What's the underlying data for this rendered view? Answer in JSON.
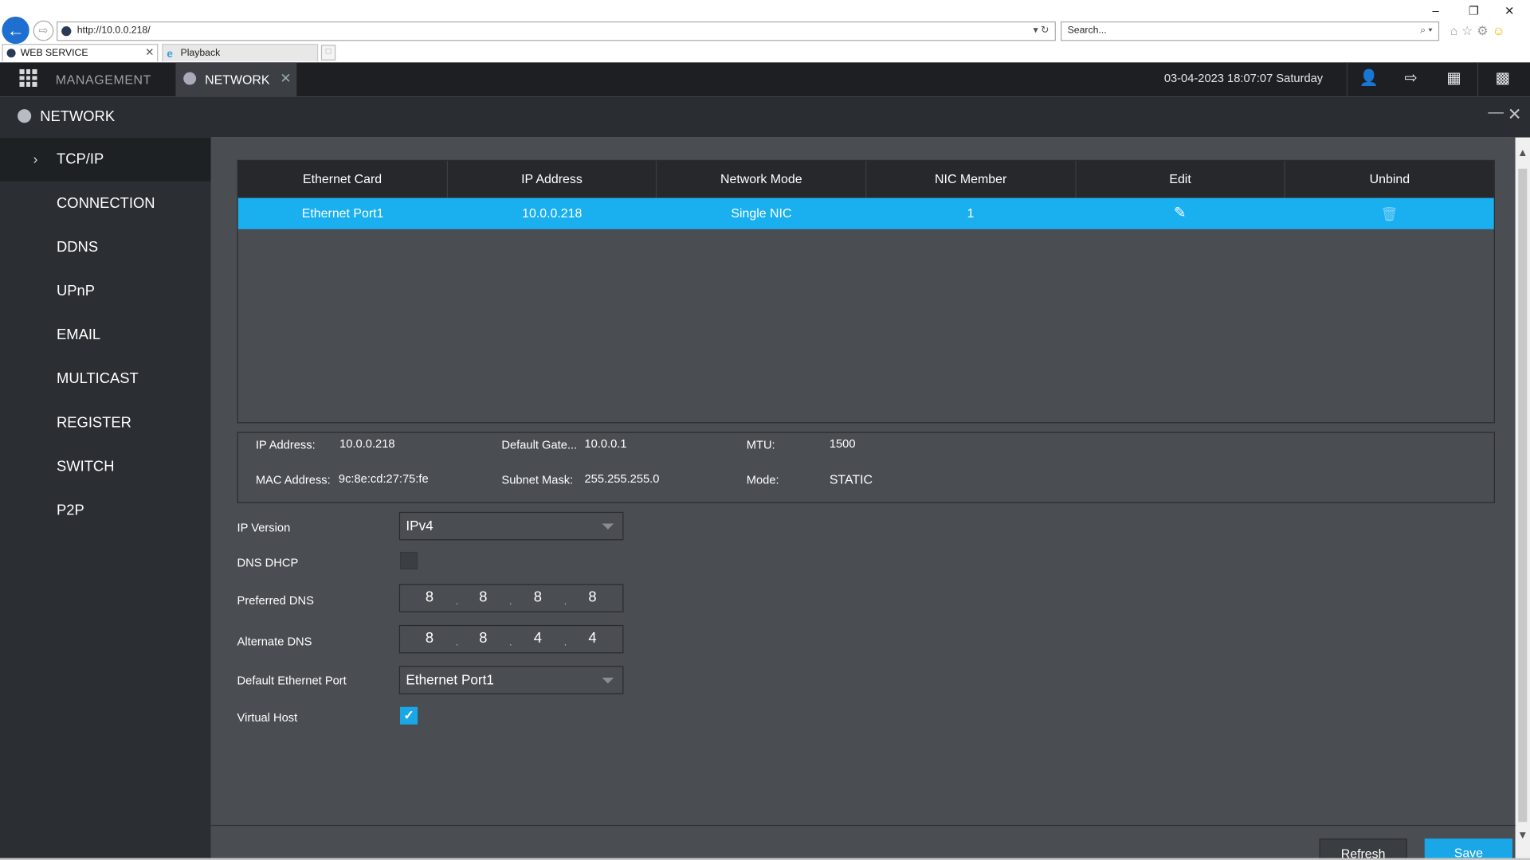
{
  "browser": {
    "url": "http://10.0.0.218/",
    "search_placeholder": "Search...",
    "tabs": [
      {
        "label": "WEB SERVICE"
      },
      {
        "label": "Playback"
      }
    ]
  },
  "header": {
    "management": "MANAGEMENT",
    "tab": "NETWORK",
    "datetime": "03-04-2023 18:07:07 Saturday"
  },
  "window": {
    "title": "NETWORK"
  },
  "sidebar": {
    "items": [
      {
        "label": "TCP/IP"
      },
      {
        "label": "CONNECTION"
      },
      {
        "label": "DDNS"
      },
      {
        "label": "UPnP"
      },
      {
        "label": "EMAIL"
      },
      {
        "label": "MULTICAST"
      },
      {
        "label": "REGISTER"
      },
      {
        "label": "SWITCH"
      },
      {
        "label": "P2P"
      }
    ]
  },
  "table": {
    "headers": [
      "Ethernet Card",
      "IP Address",
      "Network Mode",
      "NIC Member",
      "Edit",
      "Unbind"
    ],
    "rows": [
      {
        "card": "Ethernet Port1",
        "ip": "10.0.0.218",
        "mode": "Single NIC",
        "member": "1"
      }
    ]
  },
  "info": {
    "ip_label": "IP Address:",
    "ip": "10.0.0.218",
    "gateway_label": "Default Gate...",
    "gateway": "10.0.0.1",
    "mtu_label": "MTU:",
    "mtu": "1500",
    "mac_label": "MAC Address:",
    "mac": "9c:8e:cd:27:75:fe",
    "mask_label": "Subnet Mask:",
    "mask": "255.255.255.0",
    "mode_label": "Mode:",
    "mode": "STATIC"
  },
  "form": {
    "ip_version_label": "IP Version",
    "ip_version": "IPv4",
    "dns_dhcp_label": "DNS DHCP",
    "preferred_dns_label": "Preferred DNS",
    "preferred_dns": [
      "8",
      "8",
      "8",
      "8"
    ],
    "alternate_dns_label": "Alternate DNS",
    "alternate_dns": [
      "8",
      "8",
      "4",
      "4"
    ],
    "default_port_label": "Default Ethernet Port",
    "default_port": "Ethernet Port1",
    "virtual_host_label": "Virtual Host"
  },
  "buttons": {
    "refresh": "Refresh",
    "save": "Save"
  },
  "colors": {
    "accent": "#1ab0f0",
    "header_bg": "#1d1f22",
    "content_bg": "#4a4d52"
  }
}
